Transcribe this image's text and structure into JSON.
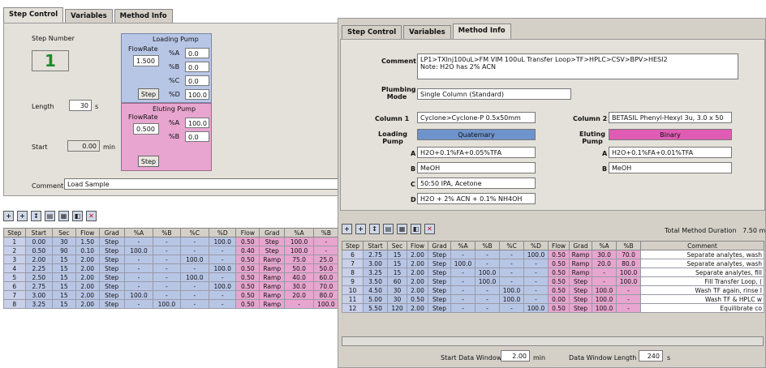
{
  "colors": {
    "blue": "#b8c6e6",
    "pink": "#e7a5cf",
    "panel": "#e4e1da",
    "chrome": "#d4d0c8"
  },
  "left": {
    "tabs": [
      "Step Control",
      "Variables",
      "Method Info"
    ],
    "step_number_label": "Step Number",
    "step_number": "1",
    "loading_pump": {
      "title": "Loading Pump",
      "flowrate_label": "FlowRate",
      "flowrate": "1.500",
      "a_label": "%A",
      "a": "0.0",
      "b_label": "%B",
      "b": "0.0",
      "c_label": "%C",
      "c": "0.0",
      "d_label": "%D",
      "d": "100.0",
      "step_btn": "Step"
    },
    "eluting_pump": {
      "title": "Eluting Pump",
      "flowrate_label": "FlowRate",
      "flowrate": "0.500",
      "a_label": "%A",
      "a": "100.0",
      "b_label": "%B",
      "b": "0.0",
      "step_btn": "Step"
    },
    "length_label": "Length",
    "length": "30",
    "length_unit": "s",
    "start_label": "Start",
    "start": "0.00",
    "start_unit": "min",
    "comment_label": "Comment",
    "comment": "Load Sample",
    "columns": [
      "Step",
      "Start",
      "Sec",
      "Flow",
      "Grad",
      "%A",
      "%B",
      "%C",
      "%D",
      "Flow",
      "Grad",
      "%A",
      "%B"
    ],
    "rows": [
      [
        "1",
        "0.00",
        "30",
        "1.50",
        "Step",
        "-",
        "-",
        "-",
        "100.0",
        "0.50",
        "Step",
        "100.0",
        "-"
      ],
      [
        "2",
        "0.50",
        "90",
        "0.10",
        "Step",
        "100.0",
        "-",
        "-",
        "-",
        "0.40",
        "Step",
        "100.0",
        "-"
      ],
      [
        "3",
        "2.00",
        "15",
        "2.00",
        "Step",
        "-",
        "-",
        "100.0",
        "-",
        "0.50",
        "Ramp",
        "75.0",
        "25.0"
      ],
      [
        "4",
        "2.25",
        "15",
        "2.00",
        "Step",
        "-",
        "-",
        "-",
        "100.0",
        "0.50",
        "Ramp",
        "50.0",
        "50.0"
      ],
      [
        "5",
        "2.50",
        "15",
        "2.00",
        "Step",
        "-",
        "-",
        "100.0",
        "-",
        "0.50",
        "Ramp",
        "40.0",
        "60.0"
      ],
      [
        "6",
        "2.75",
        "15",
        "2.00",
        "Step",
        "-",
        "-",
        "-",
        "100.0",
        "0.50",
        "Ramp",
        "30.0",
        "70.0"
      ],
      [
        "7",
        "3.00",
        "15",
        "2.00",
        "Step",
        "100.0",
        "-",
        "-",
        "-",
        "0.50",
        "Ramp",
        "20.0",
        "80.0"
      ],
      [
        "8",
        "3.25",
        "15",
        "2.00",
        "Step",
        "-",
        "100.0",
        "-",
        "-",
        "0.50",
        "Ramp",
        "-",
        "100.0"
      ]
    ]
  },
  "right": {
    "tabs": [
      "Step Control",
      "Variables",
      "Method Info"
    ],
    "comment_label": "Comment",
    "comment_line1": "LP1>TXInj100uL>FM VIM 100uL Transfer Loop>TF>HPLC>CSV>BPV>HESI2",
    "comment_line2": "Note: H2O has 2% ACN",
    "plumbing_label": "Plumbing Mode",
    "plumbing": "Single Column (Standard)",
    "column1_label": "Column 1",
    "column1": "Cyclone>Cyclone-P 0.5x50mm",
    "column2_label": "Column 2",
    "column2": "BETASIL Phenyl-Hexyl 3u, 3.0 x 50",
    "loading_pump_label": "Loading Pump",
    "loading_type": "Quaternary",
    "eluting_pump_label": "Eluting Pump",
    "eluting_type": "Binary",
    "solvent_a_label": "A",
    "solvent_a": "H2O+0.1%FA+0.05%TFA",
    "solvent_b_label": "B",
    "solvent_b": "MeOH",
    "solvent_c_label": "C",
    "solvent_c": "50:50 IPA, Acetone",
    "solvent_d_label": "D",
    "solvent_d": "H2O + 2% ACN + 0.1% NH4OH",
    "el_a_label": "A",
    "el_a": "H2O+0.1%FA+0.01%TFA",
    "el_b_label": "B",
    "el_b": "MeOH",
    "total_label": "Total Method Duration",
    "total": "7.50",
    "total_unit": "min",
    "columns": [
      "Step",
      "Start",
      "Sec",
      "Flow",
      "Grad",
      "%A",
      "%B",
      "%C",
      "%D",
      "Flow",
      "Grad",
      "%A",
      "%B",
      "Comment"
    ],
    "rows": [
      [
        "6",
        "2.75",
        "15",
        "2.00",
        "Step",
        "-",
        "-",
        "-",
        "100.0",
        "0.50",
        "Ramp",
        "30.0",
        "70.0",
        "Separate analytes, wash"
      ],
      [
        "7",
        "3.00",
        "15",
        "2.00",
        "Step",
        "100.0",
        "-",
        "-",
        "-",
        "0.50",
        "Ramp",
        "20.0",
        "80.0",
        "Separate analytes, wash"
      ],
      [
        "8",
        "3.25",
        "15",
        "2.00",
        "Step",
        "-",
        "100.0",
        "-",
        "-",
        "0.50",
        "Ramp",
        "-",
        "100.0",
        "Separate analytes, fill"
      ],
      [
        "9",
        "3.50",
        "60",
        "2.00",
        "Step",
        "-",
        "100.0",
        "-",
        "-",
        "0.50",
        "Step",
        "-",
        "100.0",
        "Fill Transfer Loop, ("
      ],
      [
        "10",
        "4.50",
        "30",
        "2.00",
        "Step",
        "-",
        "-",
        "100.0",
        "-",
        "0.50",
        "Step",
        "100.0",
        "-",
        "Wash TF again, rinse I"
      ],
      [
        "11",
        "5.00",
        "30",
        "0.50",
        "Step",
        "-",
        "-",
        "100.0",
        "-",
        "0.00",
        "Step",
        "100.0",
        "-",
        "Wash TF & HPLC w"
      ],
      [
        "12",
        "5.50",
        "120",
        "2.00",
        "Step",
        "-",
        "-",
        "-",
        "100.0",
        "0.50",
        "Step",
        "100.0",
        "-",
        "Equilibrate co"
      ]
    ],
    "start_window_label": "Start Data Window",
    "start_window": "2.00",
    "start_window_unit": "min",
    "window_length_label": "Data Window Length",
    "window_length": "240",
    "window_length_unit": "s"
  }
}
